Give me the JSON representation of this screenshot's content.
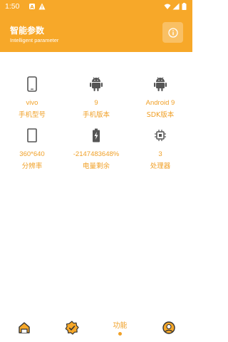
{
  "status": {
    "time": "1:50"
  },
  "header": {
    "title": "智能参数",
    "subtitle": "Intelligent parameter"
  },
  "params": [
    {
      "icon": "phone-icon",
      "value": "vivo",
      "label": "手机型号"
    },
    {
      "icon": "android-icon",
      "value": "9",
      "label": "手机版本"
    },
    {
      "icon": "android-icon",
      "value": "Android 9",
      "label": "SDK版本"
    },
    {
      "icon": "screen-icon",
      "value": "360*640",
      "label": "分辨率"
    },
    {
      "icon": "battery-icon",
      "value": "-2147483648%",
      "label": "电量剩余"
    },
    {
      "icon": "cpu-icon",
      "value": "3",
      "label": "处理器"
    }
  ],
  "nav": {
    "items": [
      {
        "icon": "home-icon",
        "label": ""
      },
      {
        "icon": "badge-check-icon",
        "label": ""
      },
      {
        "icon": "function-tab",
        "label": "功能",
        "active": true
      },
      {
        "icon": "profile-icon",
        "label": ""
      }
    ]
  },
  "colors": {
    "accent": "#f7a829",
    "text_accent": "#f0a027",
    "background": "#ffffff"
  }
}
